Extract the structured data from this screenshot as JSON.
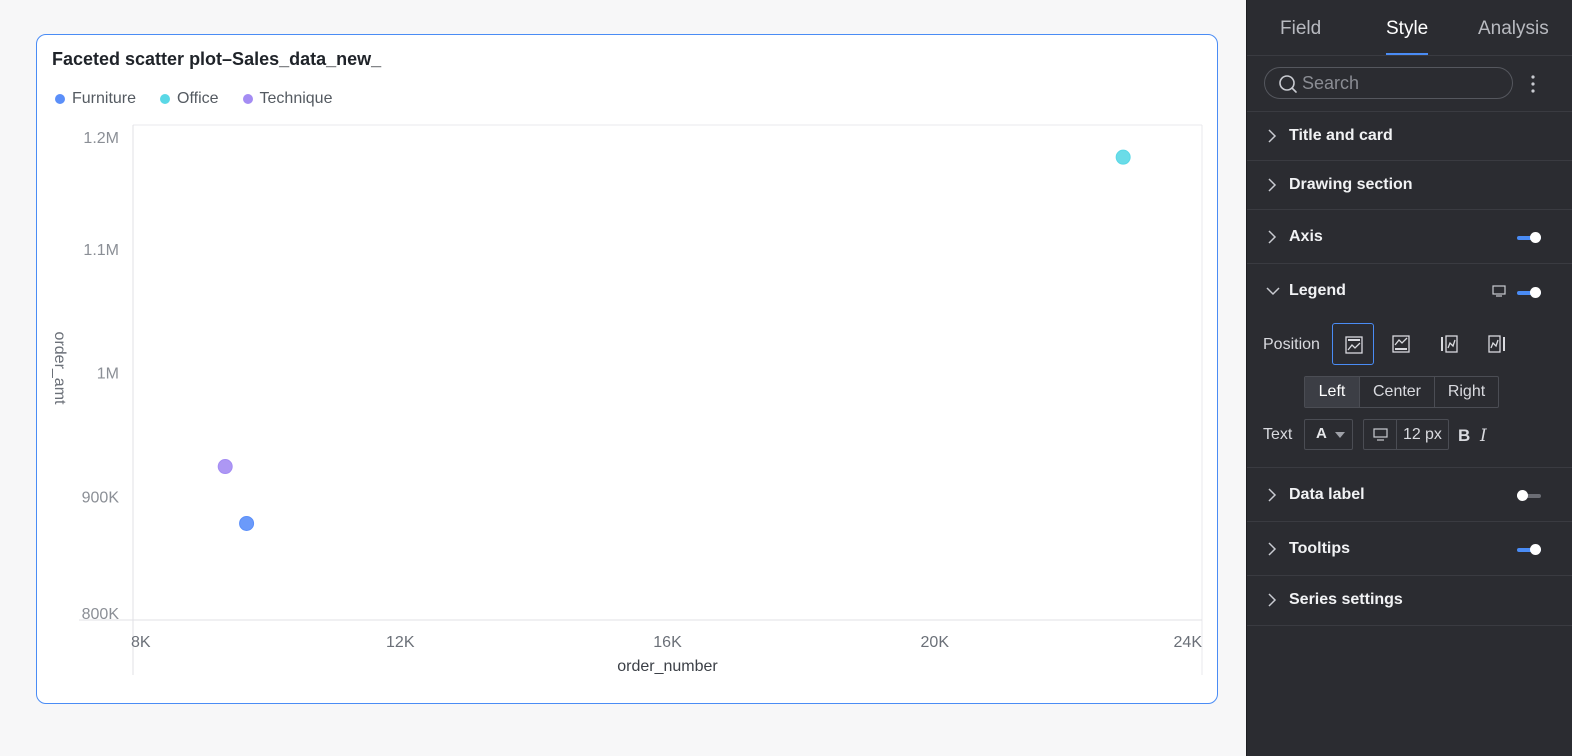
{
  "chart_card": {
    "title": "Faceted scatter plot–Sales_data_new_"
  },
  "chart_data": {
    "type": "scatter",
    "title": "Faceted scatter plot–Sales_data_new_",
    "xlabel": "order_number",
    "ylabel": "order_amt",
    "xlim": [
      8000,
      24000
    ],
    "ylim": [
      800000,
      1200000
    ],
    "x_ticks": [
      "8K",
      "12K",
      "16K",
      "20K",
      "24K"
    ],
    "x_tick_values": [
      8000,
      12000,
      16000,
      20000,
      24000
    ],
    "y_ticks": [
      "800K",
      "900K",
      "1M",
      "1.1M",
      "1.2M"
    ],
    "y_tick_values": [
      800000,
      900000,
      1000000,
      1100000,
      1200000
    ],
    "legend_position": "top-left",
    "grid": false,
    "series": [
      {
        "name": "Furniture",
        "color": "#5b8ff9",
        "points": [
          {
            "x": 9700,
            "y": 878000
          }
        ]
      },
      {
        "name": "Office",
        "color": "#5ad8e6",
        "points": [
          {
            "x": 22820,
            "y": 1174000
          }
        ]
      },
      {
        "name": "Technique",
        "color": "#a48cf3",
        "points": [
          {
            "x": 9380,
            "y": 924000
          }
        ]
      }
    ]
  },
  "panel": {
    "tabs": [
      {
        "label": "Field"
      },
      {
        "label": "Style"
      },
      {
        "label": "Analysis"
      }
    ],
    "active_tab": "Style",
    "search": {
      "placeholder": "Search",
      "value": ""
    },
    "sections": {
      "title_and_card": "Title and card",
      "drawing_section": "Drawing section",
      "axis": "Axis",
      "legend": "Legend",
      "data_label": "Data label",
      "tooltips": "Tooltips",
      "series_settings": "Series settings"
    },
    "toggles": {
      "axis": true,
      "legend": true,
      "data_label": false,
      "tooltips": true
    },
    "legend_settings": {
      "position_label": "Position",
      "align_options": [
        "Left",
        "Center",
        "Right"
      ],
      "align_selected": "Left",
      "text_label": "Text",
      "font_color_glyph": "A",
      "font_size": "12",
      "font_size_unit": "px",
      "bold_glyph": "B",
      "italic_glyph": "I"
    },
    "accent_color": "#4a8cf5"
  }
}
